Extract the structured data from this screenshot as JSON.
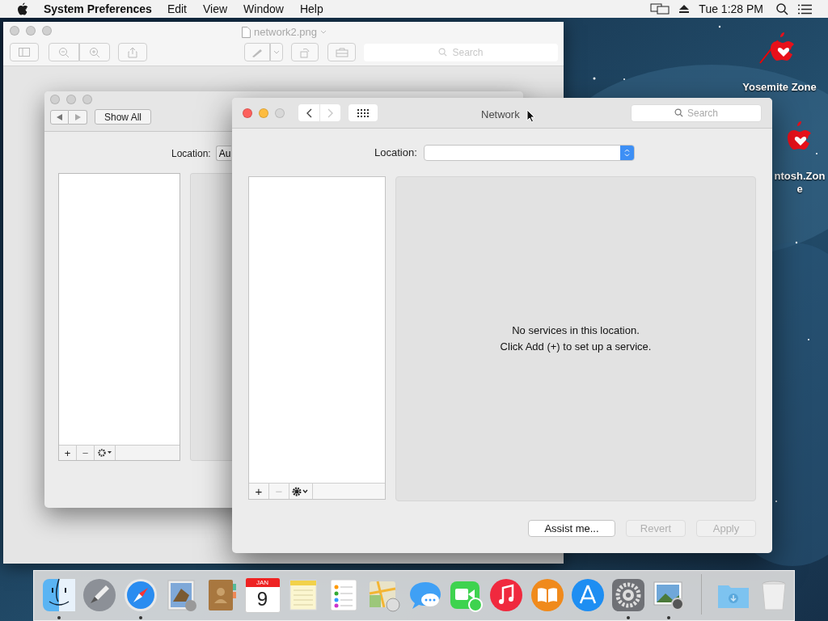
{
  "menu_bar": {
    "app_name": "System Preferences",
    "menus": [
      "Edit",
      "View",
      "Window",
      "Help"
    ],
    "clock": "Tue 1:28 PM"
  },
  "desktop_icons": [
    {
      "lines": [
        "Yosemite Zone"
      ]
    },
    {
      "lines": [
        "ntosh.Zon",
        "e"
      ]
    }
  ],
  "preview_window": {
    "title": "network2.png",
    "search": {
      "placeholder": "Search"
    }
  },
  "back_window": {
    "show_all": "Show All",
    "location_label": "Location:",
    "location_value": "Au",
    "list_buttons": [
      "+",
      "−"
    ]
  },
  "network_window": {
    "title": "Network",
    "search": {
      "placeholder": "Search"
    },
    "back_disabled": false,
    "forward_disabled": true,
    "location_label": "Location:",
    "list_buttons": [
      {
        "label": "+",
        "disabled": false
      },
      {
        "label": "−",
        "disabled": true
      }
    ],
    "message": [
      "No services in this location.",
      "Click Add (+) to set up a service."
    ],
    "buttons": [
      {
        "label": "Assist me...",
        "disabled": false
      },
      {
        "label": "Revert",
        "disabled": true
      },
      {
        "label": "Apply",
        "disabled": true
      }
    ]
  },
  "dock": {
    "items": [
      {
        "kind": "finder",
        "running": true
      },
      {
        "kind": "launchpad",
        "running": false
      },
      {
        "kind": "safari",
        "running": true
      },
      {
        "kind": "mail",
        "running": false
      },
      {
        "kind": "contacts",
        "running": false
      },
      {
        "kind": "calendar",
        "running": false,
        "month": "JAN",
        "day": "9"
      },
      {
        "kind": "notes",
        "running": false
      },
      {
        "kind": "reminders",
        "running": false
      },
      {
        "kind": "maps",
        "running": false
      },
      {
        "kind": "messages",
        "running": false
      },
      {
        "kind": "facetime",
        "running": false
      },
      {
        "kind": "itunes",
        "running": false
      },
      {
        "kind": "ibooks",
        "running": false
      },
      {
        "kind": "appstore",
        "running": false
      },
      {
        "kind": "sysprefs",
        "running": true
      },
      {
        "kind": "preview",
        "running": true
      },
      {
        "kind": "separator"
      },
      {
        "kind": "downloads",
        "running": false
      },
      {
        "kind": "trash",
        "running": false
      }
    ]
  }
}
